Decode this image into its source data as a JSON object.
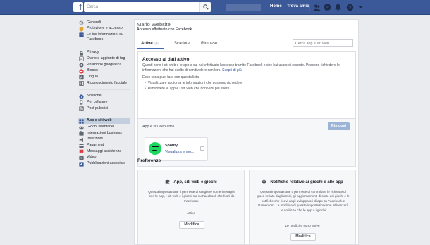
{
  "topbar": {
    "logo": "f",
    "search_placeholder": "Cerca",
    "nav": {
      "home": "Home",
      "find_friends": "Trova amici"
    }
  },
  "sidebar": {
    "groups": [
      {
        "items": [
          {
            "label": "Generali",
            "icon": "gear-icon"
          },
          {
            "label": "Protezione e accesso",
            "icon": "shield-icon"
          },
          {
            "label": "Le tue informazioni su Facebook",
            "icon": "facebook-square-icon"
          }
        ]
      },
      {
        "items": [
          {
            "label": "Privacy",
            "icon": "lock-icon"
          },
          {
            "label": "Diario e aggiunte di tag",
            "icon": "timeline-icon"
          },
          {
            "label": "Posizione geografica",
            "icon": "location-icon"
          },
          {
            "label": "Blocco",
            "icon": "block-icon"
          },
          {
            "label": "Lingua",
            "icon": "language-icon"
          },
          {
            "label": "Riconoscimento facciale",
            "icon": "face-icon"
          }
        ]
      },
      {
        "items": [
          {
            "label": "Notifiche",
            "icon": "globe-icon"
          },
          {
            "label": "Per cellulare",
            "icon": "mobile-icon"
          },
          {
            "label": "Post pubblici",
            "icon": "rss-icon"
          }
        ]
      },
      {
        "items": [
          {
            "label": "App e siti web",
            "icon": "apps-icon",
            "active": true
          },
          {
            "label": "Giochi istantanei",
            "icon": "games-icon"
          },
          {
            "label": "Integrazioni business",
            "icon": "business-icon"
          },
          {
            "label": "Inserzioni",
            "icon": "ads-icon"
          },
          {
            "label": "Pagamenti",
            "icon": "payments-icon"
          },
          {
            "label": "Messaggi assistenza",
            "icon": "support-icon"
          },
          {
            "label": "Video",
            "icon": "video-icon"
          },
          {
            "label": "Pubblicazioni associate",
            "icon": "linked-icon"
          }
        ]
      }
    ]
  },
  "main": {
    "title": "Mario Website",
    "subtitle": "Accesso effettuato con Facebook",
    "tabs": [
      {
        "label": "Attive",
        "count": "1",
        "active": true
      },
      {
        "label": "Scadute"
      },
      {
        "label": "Rimosse"
      }
    ],
    "search_placeholder": "Cerca app e siti web",
    "access": {
      "title": "Accesso ai dati attivo",
      "text": "Questi sono i siti web e le app a cui hai effettuato l'accesso tramite Facebook e che hai usato di recente. Possono richiedere le informazioni che hai scelto di condividere con loro.",
      "link": "Scopri di più",
      "list_title": "Ecco cosa puoi fare con questa lista:",
      "bullets": [
        "Visualizza e aggiorna le informazioni che possono richiedere",
        "Rimuovere le app e i siti web che non vuoi più avere"
      ]
    },
    "apps": {
      "title": "App e siti web attivi",
      "remove_label": "Rimuovi",
      "items": [
        {
          "name": "Spotify",
          "view_label": "Visualizza e mo..."
        }
      ]
    },
    "preferences": {
      "title": "Preferenze",
      "cards": [
        {
          "title": "App, siti web e giochi",
          "icon": "puzzle-icon",
          "text": "Questa impostazione ti permette di scegliere come interagire con le app, i siti web e i giochi sia su Facebook che fuori da Facebook.",
          "status": "Attive",
          "edit_label": "Modifica"
        },
        {
          "title": "Notifiche relative ai giochi e alle app",
          "icon": "cube-icon",
          "text": "Questa impostazione ti permette di controllare le richieste di gioco inviate dagli amici, gli aggiornamenti di stato dei giochi e le notifiche che ricevi dagli sviluppatori di app su Facebook e Gameroom. La modifica di queste impostazioni non influenzerà le notifiche che le app o i giochi",
          "status": "Le notifiche sono attive",
          "edit_label": "Modifica"
        }
      ]
    }
  }
}
